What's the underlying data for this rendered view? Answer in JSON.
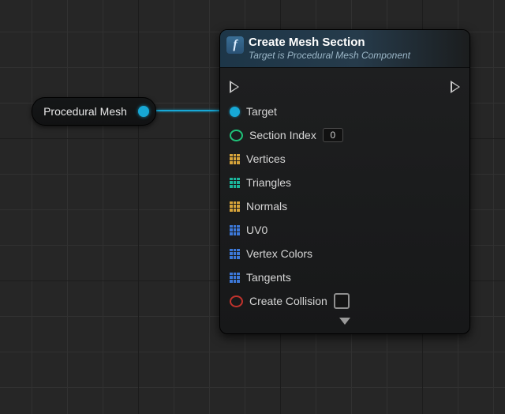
{
  "varNode": {
    "label": "Procedural Mesh"
  },
  "funcNode": {
    "title": "Create Mesh Section",
    "subtitle": "Target is Procedural Mesh Component",
    "inputs": {
      "target": {
        "label": "Target"
      },
      "sectionIndex": {
        "label": "Section Index",
        "default": "0"
      },
      "vertices": {
        "label": "Vertices"
      },
      "triangles": {
        "label": "Triangles"
      },
      "normals": {
        "label": "Normals"
      },
      "uv0": {
        "label": "UV0"
      },
      "vertexColors": {
        "label": "Vertex Colors"
      },
      "tangents": {
        "label": "Tangents"
      },
      "createCollision": {
        "label": "Create Collision",
        "default": false
      }
    }
  }
}
